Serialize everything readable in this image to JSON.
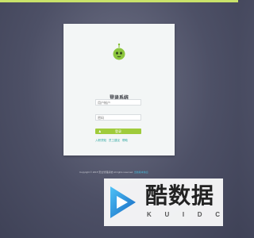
{
  "login": {
    "title": "登录系统",
    "subtitle": "欢迎使用监控系统",
    "username_placeholder": "用户帐户",
    "password_placeholder": "密码",
    "login_button_label": "登录",
    "links": [
      "入职须知",
      "员工建议",
      "帮助"
    ]
  },
  "footer": {
    "copyright": "Copyright © 2015 安全管理系统 All rights reserved.",
    "link_text": "当前版本信息"
  },
  "watermark": {
    "title": "酷数据",
    "letters": [
      "K",
      "U",
      "I",
      "D",
      "C"
    ]
  },
  "colors": {
    "accent_green": "#9fcb3b",
    "link_teal": "#2aa6a0",
    "card_bg": "#f3f6f6",
    "top_strip": "#c9e26a"
  },
  "icons": {
    "logo": "green-robot-mascot-icon",
    "button": "user-icon",
    "watermark": "play-triangle-icon"
  }
}
